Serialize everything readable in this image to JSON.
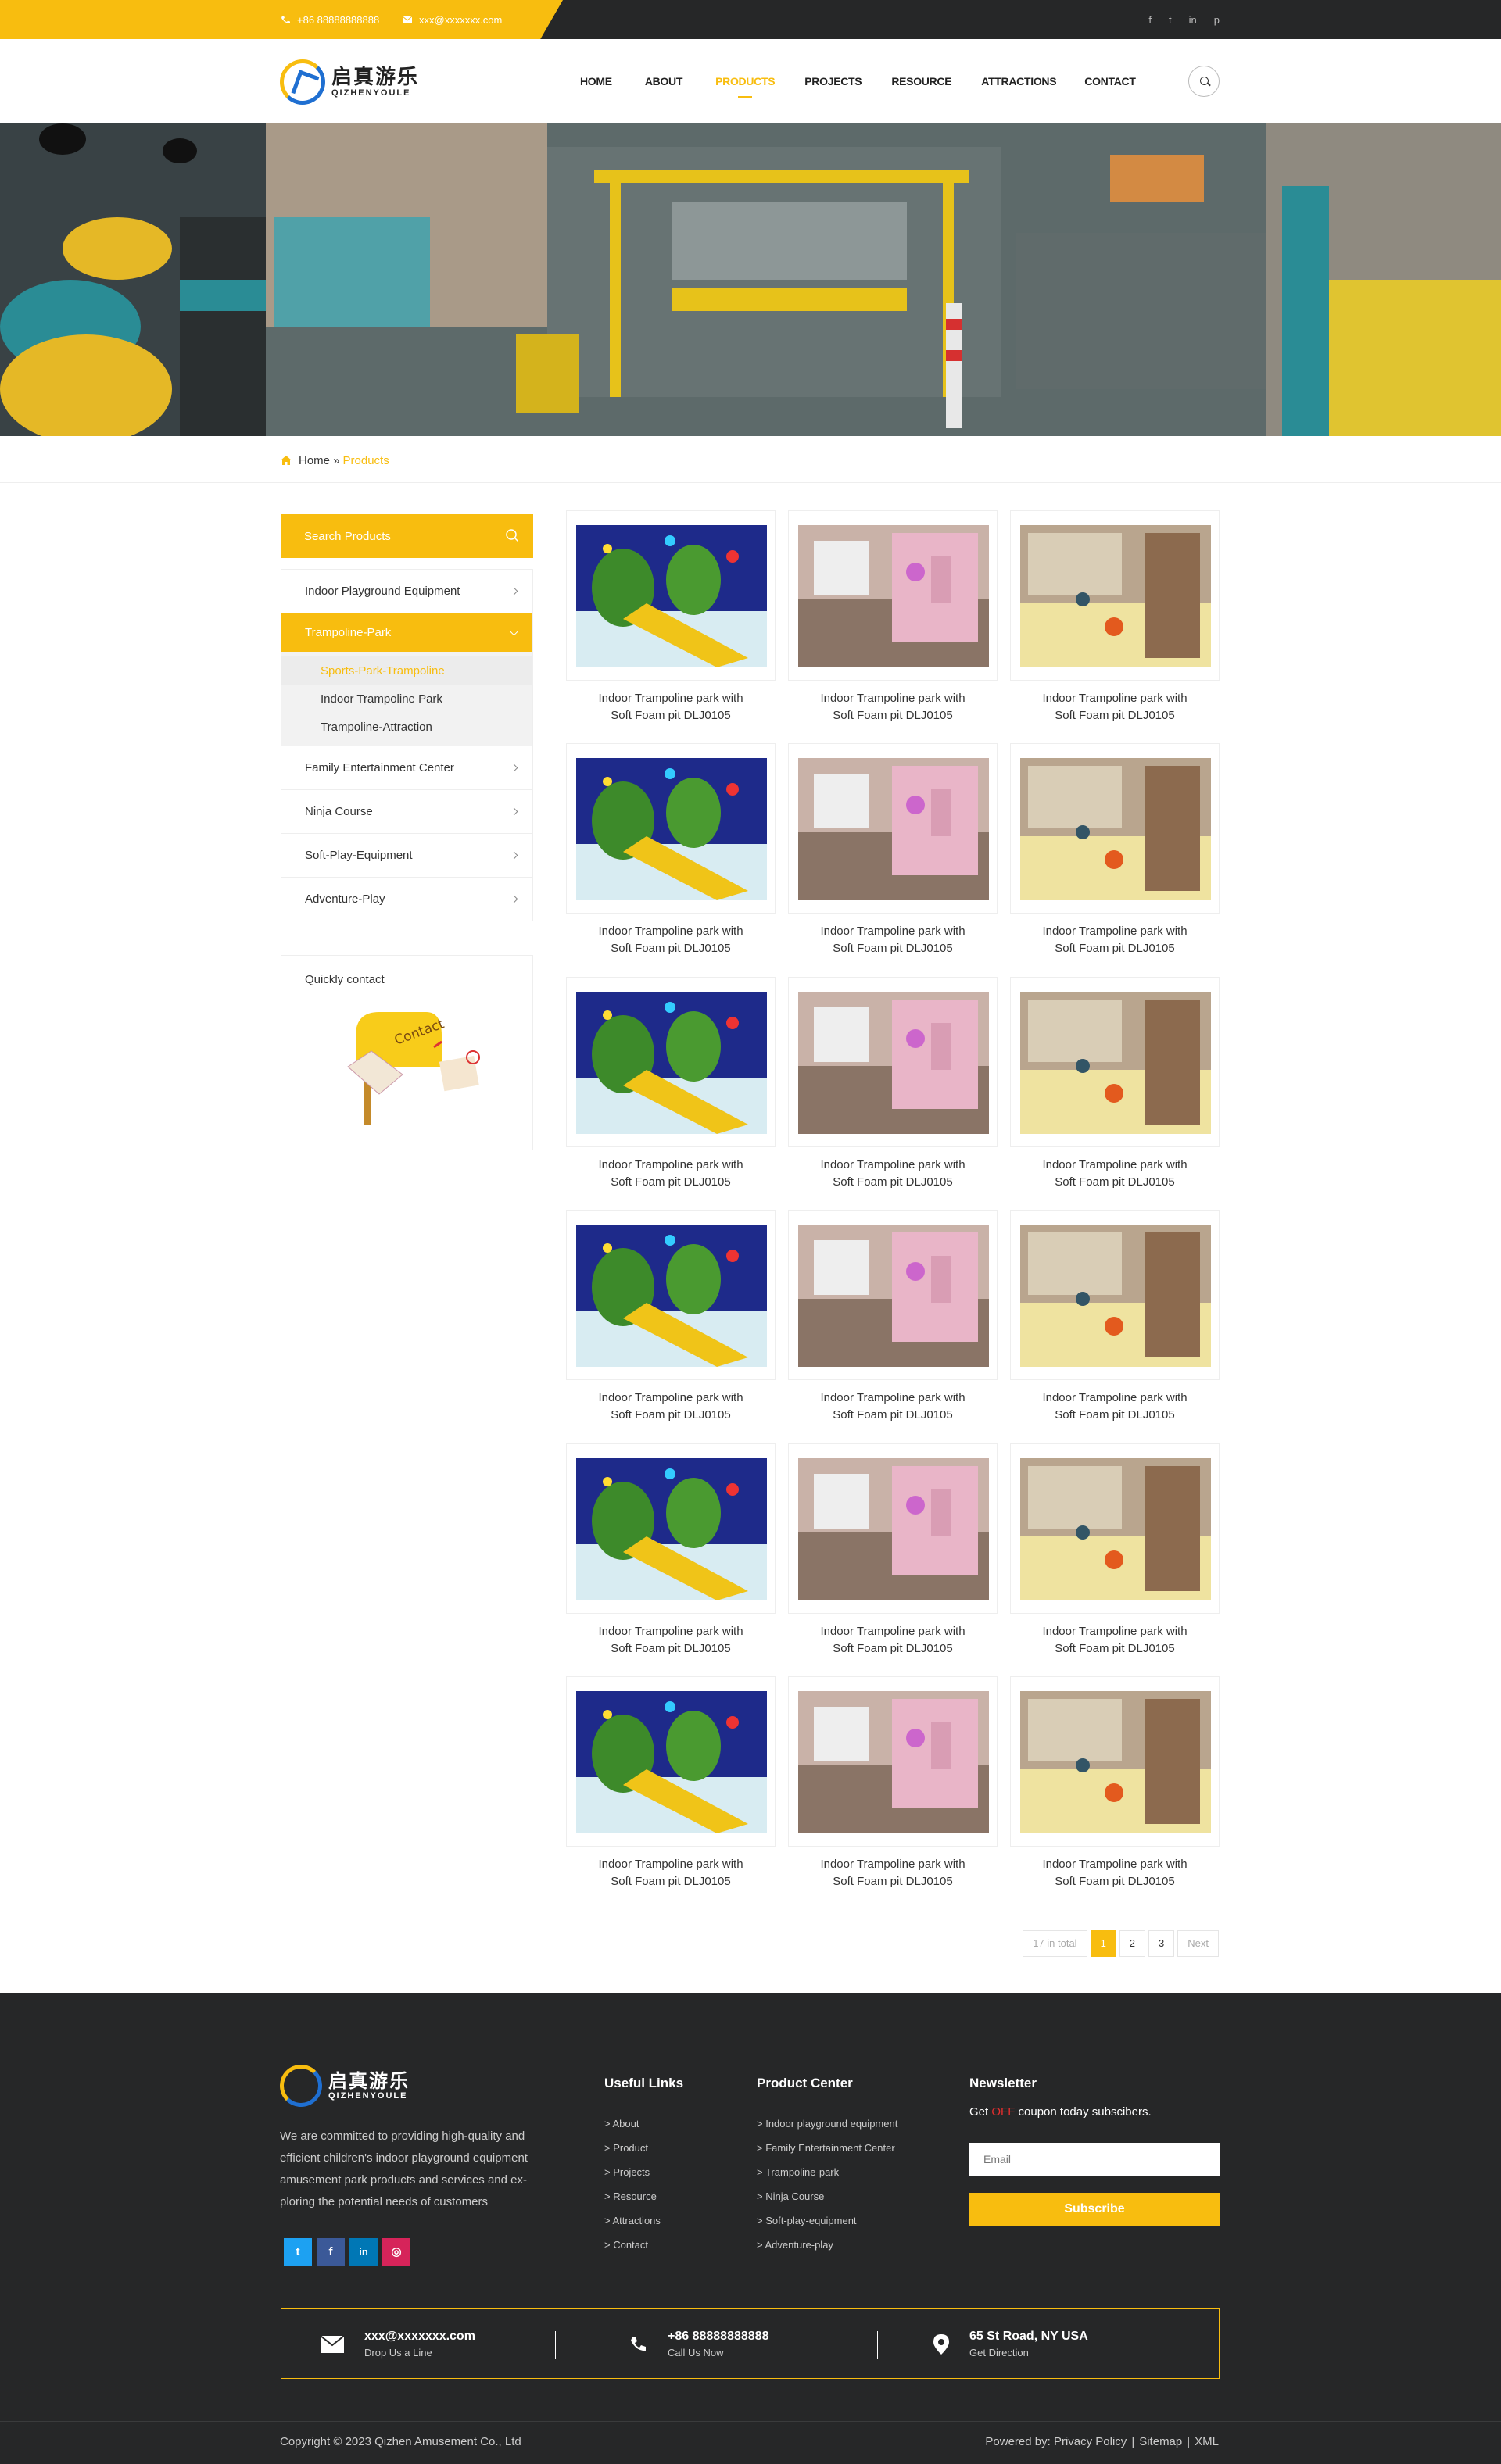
{
  "topbar": {
    "phone": "+86 88888888888",
    "email": "xxx@xxxxxxx.com",
    "social": [
      "f",
      "t",
      "in",
      "p"
    ]
  },
  "header": {
    "logo_cn": "启真游乐",
    "logo_en": "QIZHENYOULE",
    "nav": [
      "HOME",
      "ABOUT",
      "PRODUCTS",
      "PROJECTS",
      "RESOURCE",
      "ATTRACTIONS",
      "CONTACT"
    ],
    "active_nav": "PRODUCTS",
    "search_icon": "search-icon"
  },
  "breadcrumb": {
    "home": "Home",
    "separator": "»",
    "current": "Products"
  },
  "sidebar": {
    "search_label": "Search Products",
    "items": [
      {
        "label": "Indoor Playground Equipment"
      },
      {
        "label": "Trampoline-Park"
      },
      {
        "label": "Family Entertainment Center"
      },
      {
        "label": "Ninja Course"
      },
      {
        "label": "Soft-Play-Equipment"
      },
      {
        "label": "Adventure-Play"
      }
    ],
    "subitems": [
      "Sports-Park-Trampoline",
      "Indoor Trampoline Park",
      "Trampoline-Attraction"
    ],
    "quick_contact": "Quickly contact",
    "contact_badge": "Contact"
  },
  "products": [
    {
      "l1": "Indoor Trampoline park with",
      "l2": "Soft Foam pit DLJ0105"
    },
    {
      "l1": "Indoor Trampoline park with",
      "l2": "Soft Foam pit DLJ0105"
    },
    {
      "l1": "Indoor Trampoline park with",
      "l2": "Soft Foam pit DLJ0105"
    },
    {
      "l1": "Indoor Trampoline park with",
      "l2": "Soft Foam pit DLJ0105"
    },
    {
      "l1": "Indoor Trampoline park with",
      "l2": "Soft Foam pit DLJ0105"
    },
    {
      "l1": "Indoor Trampoline park with",
      "l2": "Soft Foam pit DLJ0105"
    },
    {
      "l1": "Indoor Trampoline park with",
      "l2": "Soft Foam pit DLJ0105"
    },
    {
      "l1": "Indoor Trampoline park with",
      "l2": "Soft Foam pit DLJ0105"
    },
    {
      "l1": "Indoor Trampoline park with",
      "l2": "Soft Foam pit DLJ0105"
    },
    {
      "l1": "Indoor Trampoline park with",
      "l2": "Soft Foam pit DLJ0105"
    },
    {
      "l1": "Indoor Trampoline park with",
      "l2": "Soft Foam pit DLJ0105"
    },
    {
      "l1": "Indoor Trampoline park with",
      "l2": "Soft Foam pit DLJ0105"
    },
    {
      "l1": "Indoor Trampoline park with",
      "l2": "Soft Foam pit DLJ0105"
    },
    {
      "l1": "Indoor Trampoline park with",
      "l2": "Soft Foam pit DLJ0105"
    },
    {
      "l1": "Indoor Trampoline park with",
      "l2": "Soft Foam pit DLJ0105"
    },
    {
      "l1": "Indoor Trampoline park with",
      "l2": "Soft Foam pit DLJ0105"
    },
    {
      "l1": "Indoor Trampoline park with",
      "l2": "Soft Foam pit DLJ0105"
    },
    {
      "l1": "Indoor Trampoline park with",
      "l2": "Soft Foam pit DLJ0105"
    }
  ],
  "pagination": {
    "total": "17 in total",
    "pages": [
      "1",
      "2",
      "3"
    ],
    "current": "1",
    "next": "Next"
  },
  "footer": {
    "logo_cn": "启真游乐",
    "logo_en": "QIZHENYOULE",
    "description": "We are committed to providing high-quality and efficient children's indoor playground equipment amusement park products and services and ex-ploring the potential needs of customers",
    "social": [
      "twitter",
      "facebook",
      "linkedin",
      "instagram"
    ],
    "useful_links_title": "Useful Links",
    "useful_links": [
      "> About",
      "> Product",
      "> Projects",
      "> Resource",
      "> Attractions",
      "> Contact"
    ],
    "product_center_title": "Product Center",
    "product_center": [
      "> Indoor playground equipment",
      "> Family Entertainment Center",
      "> Trampoline-park",
      "> Ninja Course",
      "> Soft-play-equipment",
      "> Adventure-play"
    ],
    "newsletter_title": "Newsletter",
    "newsletter_pre": "Get ",
    "newsletter_off": "OFF",
    "newsletter_post": " coupon today subscibers.",
    "email_placeholder": "Email",
    "subscribe": "Subscribe",
    "contacts": [
      {
        "main": "xxx@xxxxxxx.com",
        "sub": "Drop Us a Line"
      },
      {
        "main": "+86 88888888888",
        "sub": "Call Us Now"
      },
      {
        "main": "65 St Road, NY USA",
        "sub": "Get Direction"
      }
    ],
    "copyright": "Copyright © 2023 Qizhen Amusement Co., Ltd",
    "powered": "Powered by:",
    "links": [
      "Privacy Policy",
      "Sitemap",
      "XML"
    ]
  },
  "colors": {
    "accent": "#f8bd0f",
    "dark": "#262728"
  }
}
